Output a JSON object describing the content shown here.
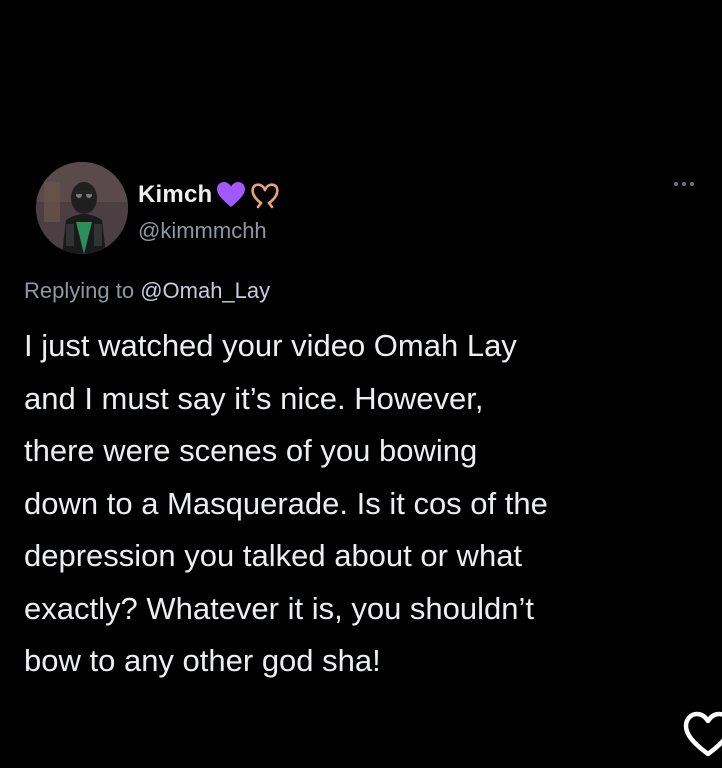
{
  "tweet": {
    "display_name": "Kimch",
    "name_emojis": [
      "purple-heart-emoji",
      "heart-hands-emoji"
    ],
    "handle": "@kimmmchh",
    "replying_prefix": "Replying to ",
    "replying_to": "@Omah_Lay",
    "body_lines": [
      "I just watched your video Omah Lay",
      "and I must say it’s nice. However,",
      "there were scenes of you bowing",
      "down to a Masquerade. Is it cos of the",
      "depression you talked about or what",
      "exactly? Whatever it is, you shouldn’t",
      "bow to any other god sha!"
    ]
  },
  "icons": {
    "more": "more-options-icon",
    "like": "heart-outline-icon"
  },
  "colors": {
    "background": "#000000",
    "text": "#eceff1",
    "secondary_text": "#8b98a5",
    "purple_heart": "#a259ff"
  }
}
